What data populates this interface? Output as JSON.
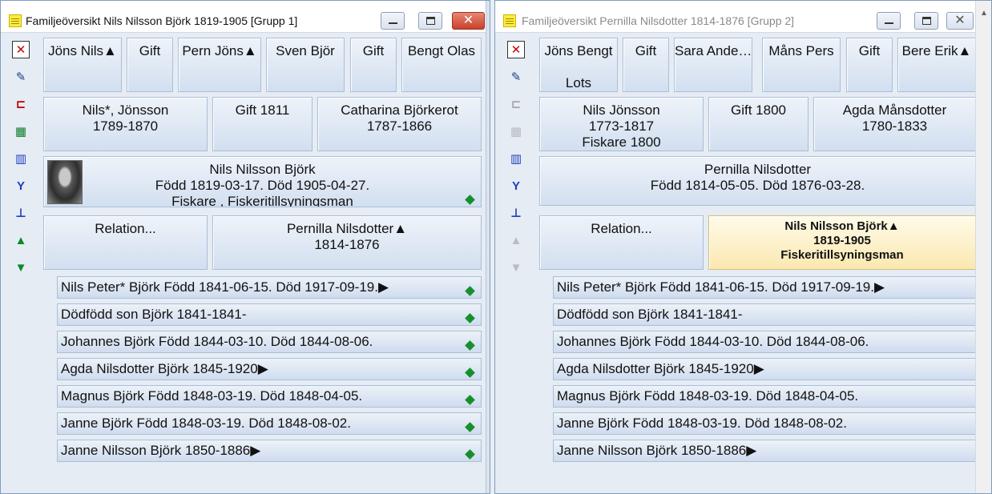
{
  "colors": {
    "accent_border": "#a9bfd8",
    "card_grad": "#d2dff0",
    "highlight": "#fbe8b0",
    "diamond": "#16902c",
    "close_red": "#c8412a"
  },
  "win1": {
    "title": "Familjeöversikt Nils Nilsson Björk 1819-1905 [Grupp 1]",
    "grandparents": [
      "Jöns Nils▲",
      "Gift",
      "Pern Jöns▲",
      "Sven Björ",
      "Gift",
      "Bengt Olas"
    ],
    "father": {
      "line1": "Nils*, Jönsson",
      "line2": "1789-1870"
    },
    "parents_marriage": "Gift 1811",
    "mother": {
      "line1": "Catharina Björkerot",
      "line2": "1787-1866"
    },
    "main": {
      "line1": "Nils Nilsson Björk",
      "line2": "Född 1819-03-17. Död 1905-04-27.",
      "line3": "Fiskare , Fiskeritillsyningsman"
    },
    "relation": "Relation...",
    "spouse": {
      "line1": "Pernilla Nilsdotter▲",
      "line2": "1814-1876"
    },
    "children": [
      "Nils Peter* Björk Född 1841-06-15. Död 1917-09-19.▶",
      "Dödfödd son Björk 1841-1841-",
      "Johannes Björk Född 1844-03-10. Död 1844-08-06.",
      "Agda Nilsdotter Björk 1845-1920▶",
      "Magnus Björk Född 1848-03-19. Död 1848-04-05.",
      "Janne Björk Född 1848-03-19. Död 1848-08-02.",
      "Janne Nilsson Björk 1850-1886▶"
    ]
  },
  "win2": {
    "title": "Familjeöversikt Pernilla Nilsdotter 1814-1876 [Grupp 2]",
    "grandparents": [
      "Jöns Bengt",
      "Gift",
      "Sara Ande…",
      "Måns Pers",
      "Gift",
      "Bere Erik▲"
    ],
    "grandparent_extra": "Lots",
    "father": {
      "line1": "Nils Jönsson",
      "line2": "1773-1817",
      "line3": "Fiskare  1800"
    },
    "parents_marriage": "Gift 1800",
    "mother": {
      "line1": "Agda Månsdotter",
      "line2": "1780-1833"
    },
    "main": {
      "line1": "Pernilla Nilsdotter",
      "line2": "Född 1814-05-05. Död 1876-03-28."
    },
    "relation": "Relation...",
    "spouse": {
      "line1": "Nils Nilsson Björk▲",
      "line2": "1819-1905",
      "line3": "Fiskeritillsyningsman"
    },
    "children": [
      "Nils Peter* Björk Född 1841-06-15. Död 1917-09-19.▶",
      "Dödfödd son Björk 1841-1841-",
      "Johannes Björk Född 1844-03-10. Död 1844-08-06.",
      "Agda Nilsdotter Björk 1845-1920▶",
      "Magnus Björk Född 1848-03-19. Död 1848-04-05.",
      "Janne Björk Född 1848-03-19. Död 1848-08-02.",
      "Janne Nilsson Björk 1850-1886▶"
    ]
  },
  "icons": [
    "close-red-icon",
    "edit-note-icon",
    "tree-icon",
    "chart-icon",
    "columns-icon",
    "fork-icon",
    "org-icon",
    "up-arrow-icon",
    "down-arrow-icon"
  ]
}
